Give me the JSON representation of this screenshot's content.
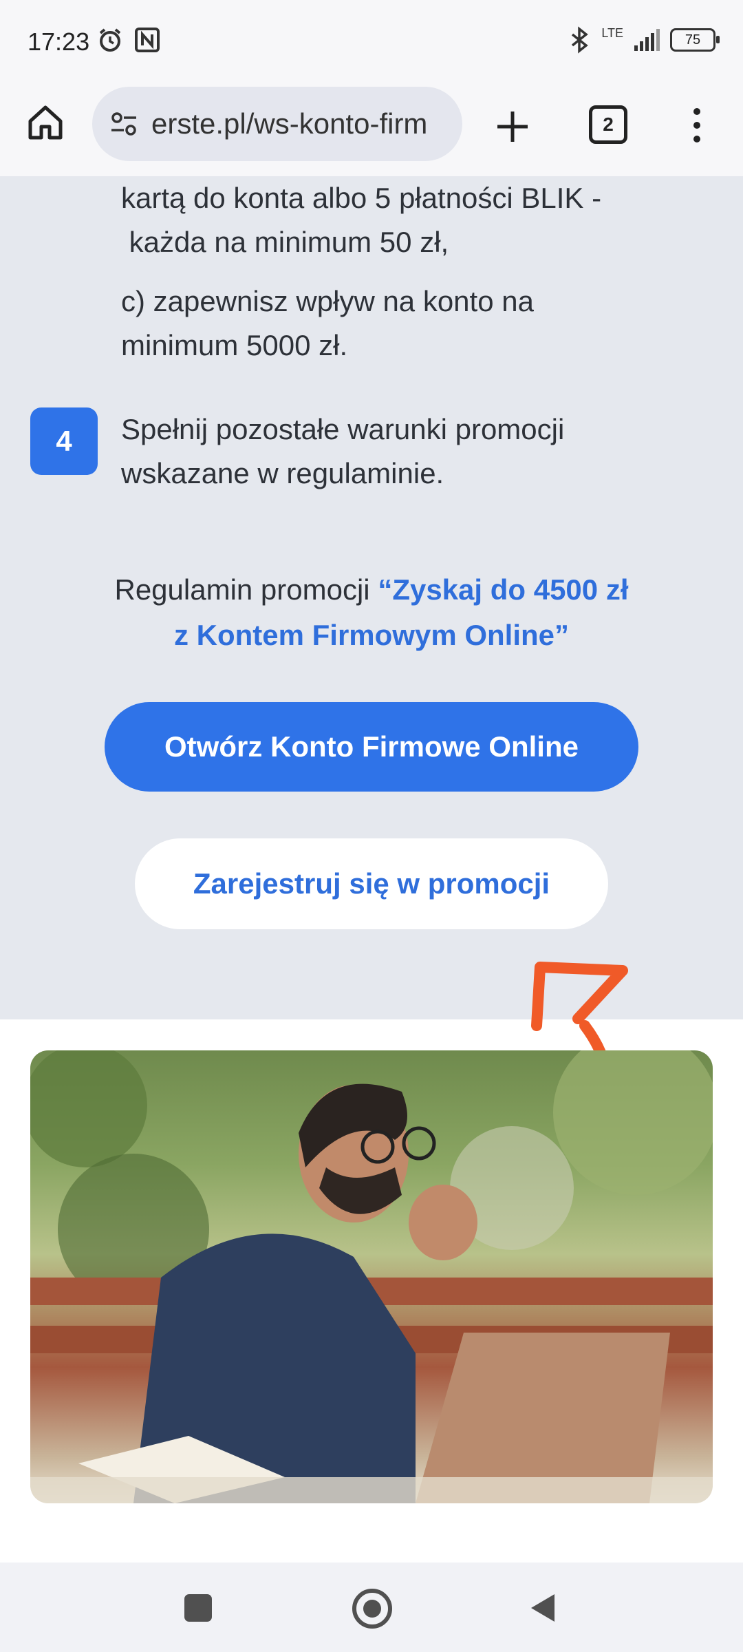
{
  "status_bar": {
    "time": "17:23",
    "network": "LTE",
    "battery": "75"
  },
  "browser": {
    "url": "erste.pl/ws-konto-firm",
    "tab_count": "2"
  },
  "steps": {
    "continued_line1": "kartą do konta albo 5 płatności BLIK -",
    "continued_line2": " każda na minimum 50 zł,",
    "c_line1": "c) zapewnisz wpływ na konto na",
    "c_line2": "minimum 5000 zł.",
    "step4_number": "4",
    "step4_line1": "Spełnij pozostałe warunki promocji",
    "step4_line2": "wskazane w regulaminie."
  },
  "regulations": {
    "prefix": "Regulamin promocji",
    "link_line1": "“Zyskaj do 4500 zł",
    "link_line2": "z Kontem Firmowym Online”"
  },
  "buttons": {
    "open_account": "Otwórz Konto Firmowe Online",
    "register": "Zarejestruj się w promocji"
  },
  "colors": {
    "accent": "#2f73e8",
    "page_bg": "#e5e8ee",
    "annotation": "#f05a28"
  }
}
